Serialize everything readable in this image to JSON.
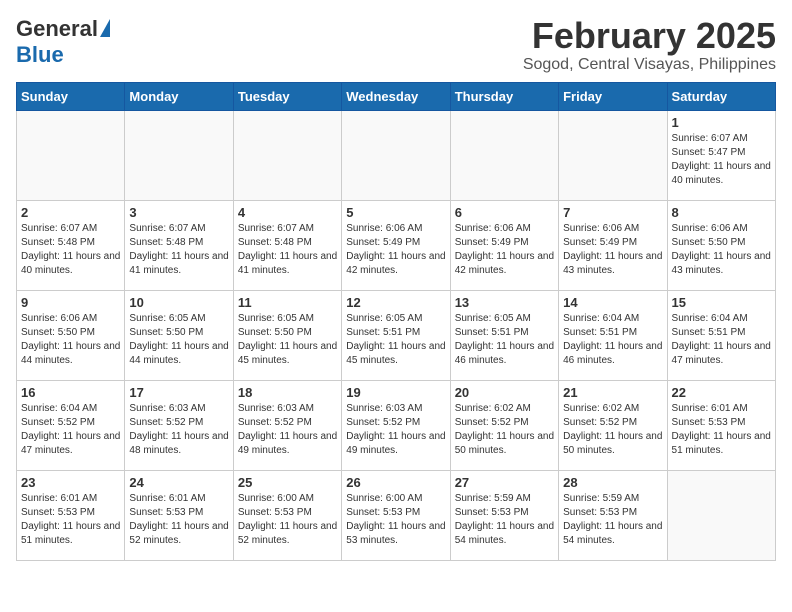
{
  "header": {
    "logo_general": "General",
    "logo_blue": "Blue",
    "title": "February 2025",
    "subtitle": "Sogod, Central Visayas, Philippines"
  },
  "calendar": {
    "days_of_week": [
      "Sunday",
      "Monday",
      "Tuesday",
      "Wednesday",
      "Thursday",
      "Friday",
      "Saturday"
    ],
    "weeks": [
      [
        {
          "day": null,
          "info": ""
        },
        {
          "day": null,
          "info": ""
        },
        {
          "day": null,
          "info": ""
        },
        {
          "day": null,
          "info": ""
        },
        {
          "day": null,
          "info": ""
        },
        {
          "day": null,
          "info": ""
        },
        {
          "day": "1",
          "info": "Sunrise: 6:07 AM\nSunset: 5:47 PM\nDaylight: 11 hours and 40 minutes."
        }
      ],
      [
        {
          "day": "2",
          "info": "Sunrise: 6:07 AM\nSunset: 5:48 PM\nDaylight: 11 hours and 40 minutes."
        },
        {
          "day": "3",
          "info": "Sunrise: 6:07 AM\nSunset: 5:48 PM\nDaylight: 11 hours and 41 minutes."
        },
        {
          "day": "4",
          "info": "Sunrise: 6:07 AM\nSunset: 5:48 PM\nDaylight: 11 hours and 41 minutes."
        },
        {
          "day": "5",
          "info": "Sunrise: 6:06 AM\nSunset: 5:49 PM\nDaylight: 11 hours and 42 minutes."
        },
        {
          "day": "6",
          "info": "Sunrise: 6:06 AM\nSunset: 5:49 PM\nDaylight: 11 hours and 42 minutes."
        },
        {
          "day": "7",
          "info": "Sunrise: 6:06 AM\nSunset: 5:49 PM\nDaylight: 11 hours and 43 minutes."
        },
        {
          "day": "8",
          "info": "Sunrise: 6:06 AM\nSunset: 5:50 PM\nDaylight: 11 hours and 43 minutes."
        }
      ],
      [
        {
          "day": "9",
          "info": "Sunrise: 6:06 AM\nSunset: 5:50 PM\nDaylight: 11 hours and 44 minutes."
        },
        {
          "day": "10",
          "info": "Sunrise: 6:05 AM\nSunset: 5:50 PM\nDaylight: 11 hours and 44 minutes."
        },
        {
          "day": "11",
          "info": "Sunrise: 6:05 AM\nSunset: 5:50 PM\nDaylight: 11 hours and 45 minutes."
        },
        {
          "day": "12",
          "info": "Sunrise: 6:05 AM\nSunset: 5:51 PM\nDaylight: 11 hours and 45 minutes."
        },
        {
          "day": "13",
          "info": "Sunrise: 6:05 AM\nSunset: 5:51 PM\nDaylight: 11 hours and 46 minutes."
        },
        {
          "day": "14",
          "info": "Sunrise: 6:04 AM\nSunset: 5:51 PM\nDaylight: 11 hours and 46 minutes."
        },
        {
          "day": "15",
          "info": "Sunrise: 6:04 AM\nSunset: 5:51 PM\nDaylight: 11 hours and 47 minutes."
        }
      ],
      [
        {
          "day": "16",
          "info": "Sunrise: 6:04 AM\nSunset: 5:52 PM\nDaylight: 11 hours and 47 minutes."
        },
        {
          "day": "17",
          "info": "Sunrise: 6:03 AM\nSunset: 5:52 PM\nDaylight: 11 hours and 48 minutes."
        },
        {
          "day": "18",
          "info": "Sunrise: 6:03 AM\nSunset: 5:52 PM\nDaylight: 11 hours and 49 minutes."
        },
        {
          "day": "19",
          "info": "Sunrise: 6:03 AM\nSunset: 5:52 PM\nDaylight: 11 hours and 49 minutes."
        },
        {
          "day": "20",
          "info": "Sunrise: 6:02 AM\nSunset: 5:52 PM\nDaylight: 11 hours and 50 minutes."
        },
        {
          "day": "21",
          "info": "Sunrise: 6:02 AM\nSunset: 5:52 PM\nDaylight: 11 hours and 50 minutes."
        },
        {
          "day": "22",
          "info": "Sunrise: 6:01 AM\nSunset: 5:53 PM\nDaylight: 11 hours and 51 minutes."
        }
      ],
      [
        {
          "day": "23",
          "info": "Sunrise: 6:01 AM\nSunset: 5:53 PM\nDaylight: 11 hours and 51 minutes."
        },
        {
          "day": "24",
          "info": "Sunrise: 6:01 AM\nSunset: 5:53 PM\nDaylight: 11 hours and 52 minutes."
        },
        {
          "day": "25",
          "info": "Sunrise: 6:00 AM\nSunset: 5:53 PM\nDaylight: 11 hours and 52 minutes."
        },
        {
          "day": "26",
          "info": "Sunrise: 6:00 AM\nSunset: 5:53 PM\nDaylight: 11 hours and 53 minutes."
        },
        {
          "day": "27",
          "info": "Sunrise: 5:59 AM\nSunset: 5:53 PM\nDaylight: 11 hours and 54 minutes."
        },
        {
          "day": "28",
          "info": "Sunrise: 5:59 AM\nSunset: 5:53 PM\nDaylight: 11 hours and 54 minutes."
        },
        {
          "day": null,
          "info": ""
        }
      ]
    ]
  }
}
